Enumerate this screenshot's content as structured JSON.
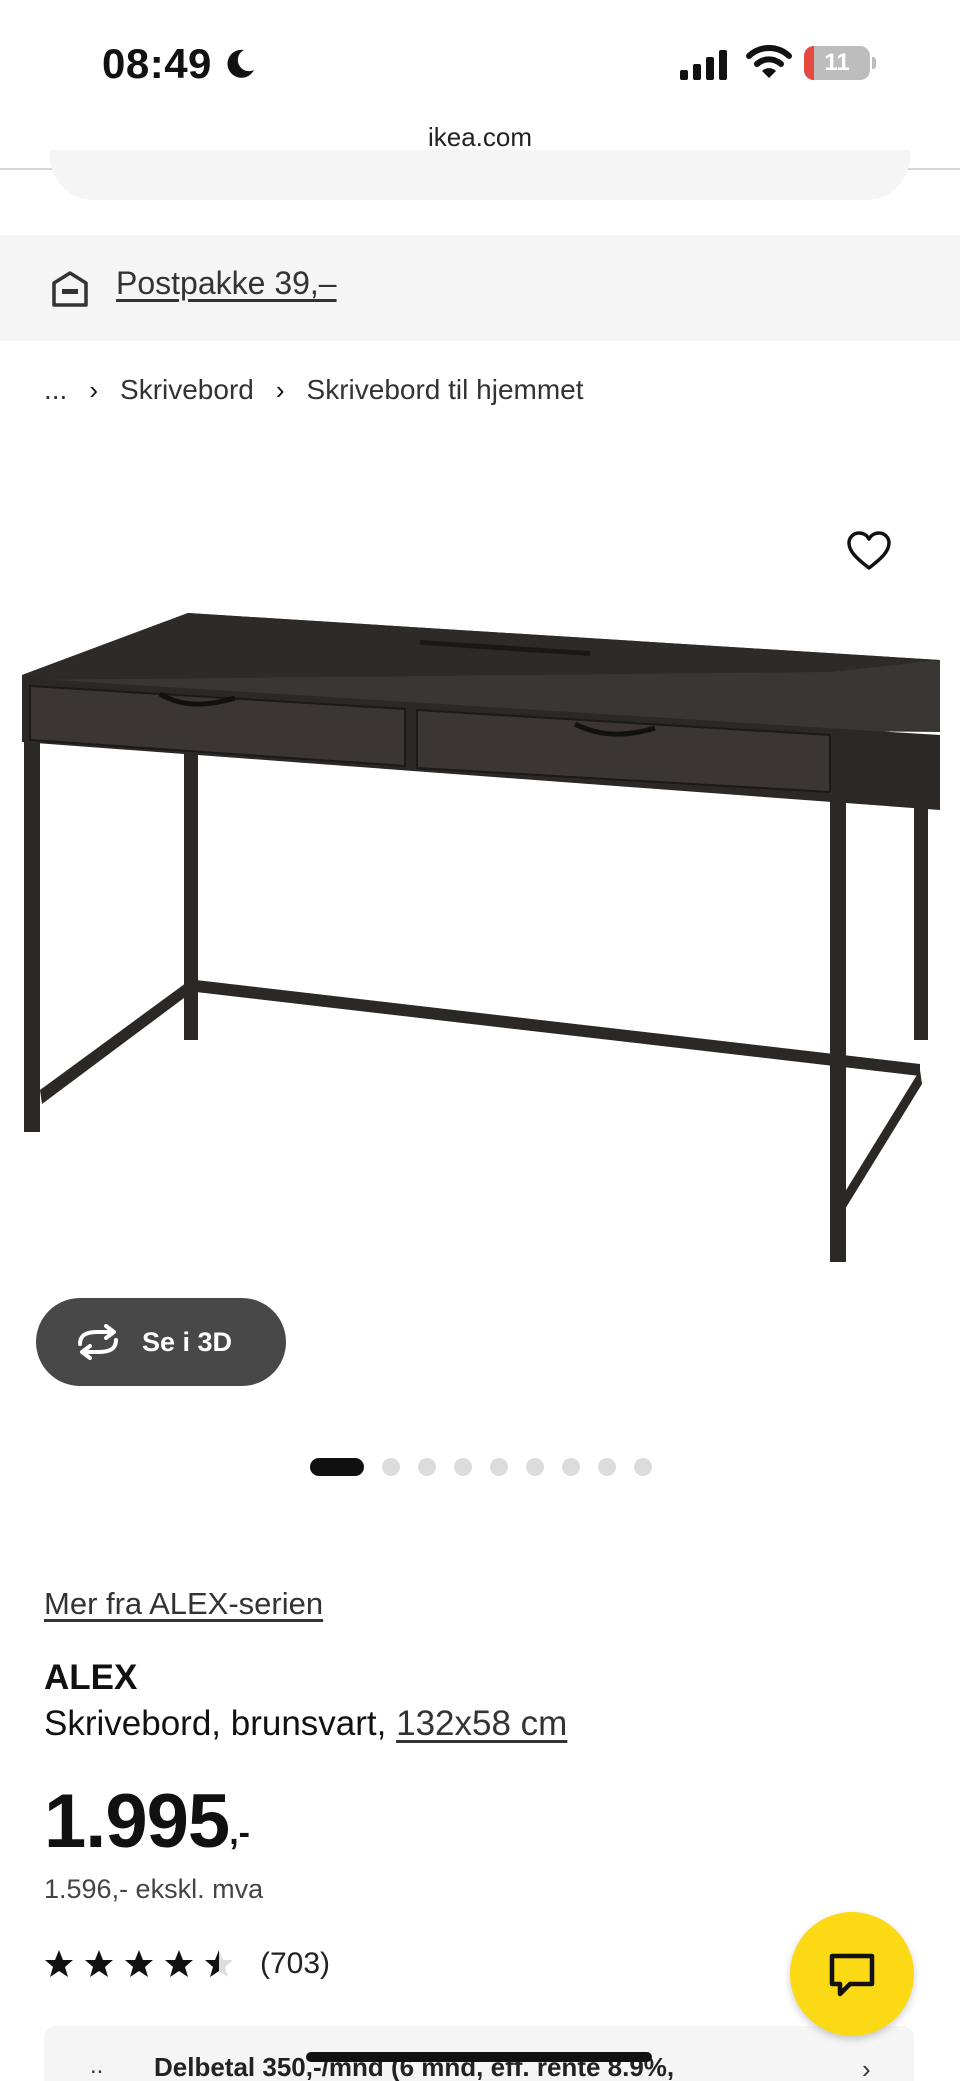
{
  "status_bar": {
    "time": "08:49",
    "battery_level": "11",
    "icons": [
      "moon-icon",
      "signal-icon",
      "wifi-icon",
      "battery-icon"
    ]
  },
  "browser": {
    "url": "ikea.com"
  },
  "delivery": {
    "label": "Postpakke 39,–",
    "icon": "store-box-icon"
  },
  "breadcrumb": {
    "items": [
      "...",
      "Skrivebord",
      "Skrivebord til hjemmet"
    ]
  },
  "gallery": {
    "view_3d_label": "Se i 3D",
    "image_count": 9,
    "active_index": 0
  },
  "product": {
    "series_link": "Mer fra ALEX-serien",
    "name": "ALEX",
    "description": "Skrivebord, brunsvart,",
    "size": "132x58 cm",
    "price_int": "1.995",
    "price_dec": ",-",
    "price_excl_vat": "1.596,- ekskl. mva",
    "rating": 4.5,
    "review_count": "(703)"
  },
  "finance": {
    "prefix": "..",
    "text": "Delbetal 350,-/mnd (6 mnd, eff. rente 8.9%,",
    "chevron": "›"
  },
  "colors": {
    "fab": "#fbd914",
    "banner_bg": "#f5f5f5",
    "btn_3d_bg": "#484848",
    "desk": "#2b2826"
  }
}
